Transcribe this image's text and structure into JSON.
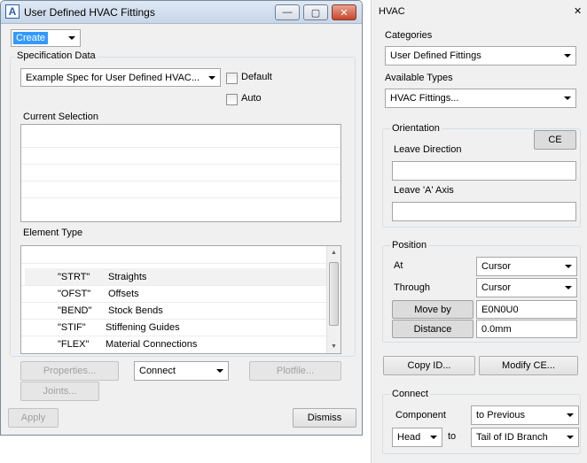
{
  "left_window": {
    "title": "User Defined HVAC Fittings",
    "title_icon_glyph": "A",
    "window_controls": {
      "minimize": "—",
      "maximize": "▢",
      "close": "✕"
    },
    "mode_combo": "Create",
    "spec_group_label": "Specification Data",
    "spec_combo": "Example Spec for User Defined HVAC...",
    "default_label": "Default",
    "auto_label": "Auto",
    "current_selection_label": "Current Selection",
    "element_type_label": "Element Type",
    "element_types": [
      {
        "code": "\"STRT\"",
        "name": "Straights"
      },
      {
        "code": "\"OFST\"",
        "name": "Offsets"
      },
      {
        "code": "\"BEND\"",
        "name": "Stock Bends"
      },
      {
        "code": "\"STIF\"",
        "name": "Stiffening Guides"
      },
      {
        "code": "\"FLEX\"",
        "name": "Material Connections"
      }
    ],
    "properties_button": "Properties...",
    "connect_combo": "Connect",
    "plotfile_button": "Plotfile...",
    "joints_button": "Joints...",
    "apply_button": "Apply",
    "dismiss_button": "Dismiss"
  },
  "right_panel": {
    "title": "HVAC",
    "close_glyph": "✕",
    "categories_label": "Categories",
    "categories_combo": "User Defined Fittings",
    "available_types_label": "Available Types",
    "available_types_combo": "HVAC Fittings...",
    "orientation_label": "Orientation",
    "ce_button": "CE",
    "leave_direction_label": "Leave Direction",
    "leave_direction_value": "",
    "leave_a_axis_label": "Leave 'A' Axis",
    "leave_a_axis_value": "",
    "position_label": "Position",
    "at_label": "At",
    "at_combo": "Cursor",
    "through_label": "Through",
    "through_combo": "Cursor",
    "move_by_button": "Move by",
    "move_by_value": "E0N0U0",
    "distance_button": "Distance",
    "distance_value": "0.0mm",
    "copy_id_button": "Copy ID...",
    "modify_ce_button": "Modify CE...",
    "connect_label": "Connect",
    "component_label": "Component",
    "component_combo": "to Previous",
    "head_combo": "Head",
    "to_label": "to",
    "tail_combo": "Tail of ID Branch"
  }
}
